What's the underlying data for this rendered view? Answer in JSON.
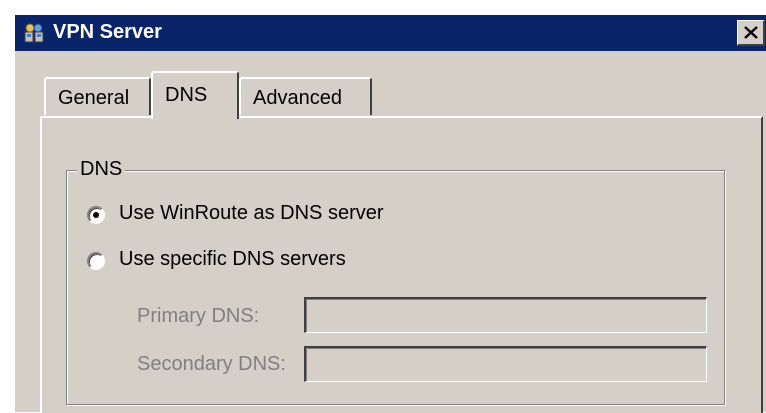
{
  "window": {
    "title": "VPN Server",
    "icon": "vpn-server-app-icon",
    "close_icon": "close-icon"
  },
  "tabs": [
    {
      "label": "General",
      "active": false
    },
    {
      "label": "DNS",
      "active": true
    },
    {
      "label": "Advanced",
      "active": false
    }
  ],
  "dns_group": {
    "legend": "DNS",
    "options": [
      {
        "label": "Use WinRoute as DNS server",
        "selected": true
      },
      {
        "label": "Use specific DNS servers",
        "selected": false
      }
    ],
    "primary": {
      "label": "Primary DNS:",
      "value": "",
      "enabled": false
    },
    "secondary": {
      "label": "Secondary DNS:",
      "value": "",
      "enabled": false
    }
  },
  "colors": {
    "titlebar": "#0a246a",
    "face": "#d4d0c8",
    "disabled_text": "#808080"
  }
}
